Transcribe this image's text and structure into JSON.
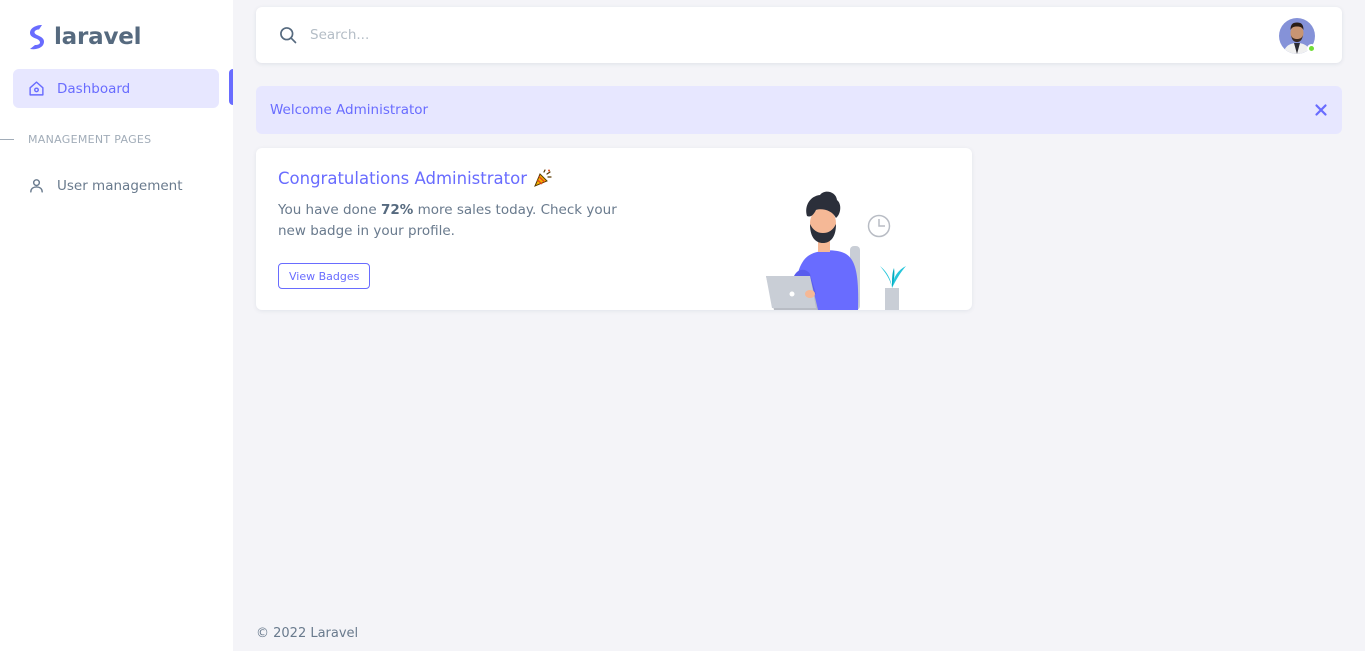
{
  "brand": {
    "name": "laravel"
  },
  "sidebar": {
    "items": [
      {
        "label": "Dashboard",
        "icon": "home-icon",
        "active": true
      },
      {
        "label": "User management",
        "icon": "user-icon",
        "active": false
      }
    ],
    "section_header": "MANAGEMENT PAGES"
  },
  "navbar": {
    "search_placeholder": "Search...",
    "search_value": "",
    "avatar_status": "online"
  },
  "alert": {
    "text": "Welcome Administrator"
  },
  "card": {
    "title": "Congratulations Administrator",
    "text_before": "You have done ",
    "highlight": "72%",
    "text_after": " more sales today. Check your new badge in your profile.",
    "button_label": "View Badges"
  },
  "footer": {
    "text": "© 2022 Laravel"
  },
  "colors": {
    "primary": "#696cff",
    "primary_light": "#e7e7ff",
    "heading": "#566a7f",
    "body": "#697a8d",
    "background": "#f4f4f8",
    "online": "#71dd37"
  }
}
